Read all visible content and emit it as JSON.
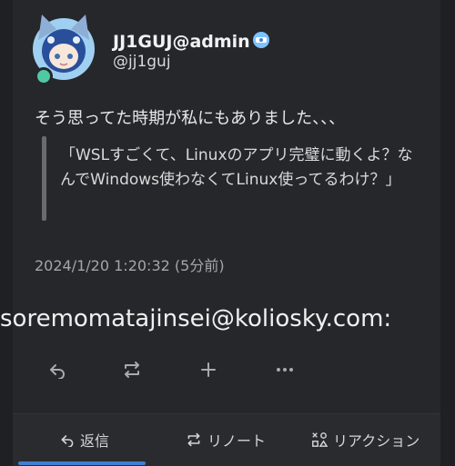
{
  "post": {
    "display_name": "JJ1GUJ@admin",
    "handle": "@jj1guj",
    "body": "そう思ってた時期が私にもありました、、、",
    "quote": "「WSLすごくて、Linuxのアプリ完璧に動くよ？なんでWindows使わなくてLinux使ってるわけ？」",
    "timestamp": "2024/1/20 1:20:32 (5分前)",
    "email": "soremomatajinsei@koliosky.com:"
  },
  "actions": {
    "icons": [
      "reply-icon",
      "renote-icon",
      "plus-icon",
      "more-icon"
    ]
  },
  "footer": {
    "reply_label": "返信",
    "renote_label": "リノート",
    "reaction_label": "リアクション"
  },
  "colors": {
    "background": "#1f2023",
    "card": "#26272b",
    "online": "#4ec9a4",
    "accent": "#3f7fd3"
  }
}
